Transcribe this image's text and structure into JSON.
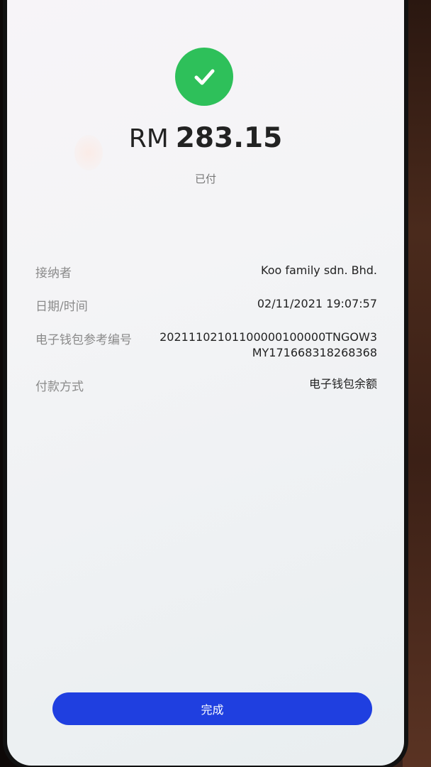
{
  "payment": {
    "currency": "RM",
    "amount": "283.15",
    "status": "已付"
  },
  "details": [
    {
      "label": "接纳者",
      "value": "Koo family sdn. Bhd."
    },
    {
      "label": "日期/时间",
      "value": "02/11/2021 19:07:57"
    },
    {
      "label": "电子钱包参考编号",
      "value": "20211102101100000100000TNGOW3\nMY171668318268368"
    },
    {
      "label": "付款方式",
      "value": "电子钱包余额"
    }
  ],
  "actions": {
    "done_label": "完成"
  },
  "colors": {
    "success": "#2ec05a",
    "primary_button": "#1f3fe0"
  },
  "icons": {
    "status_icon": "check-icon"
  }
}
